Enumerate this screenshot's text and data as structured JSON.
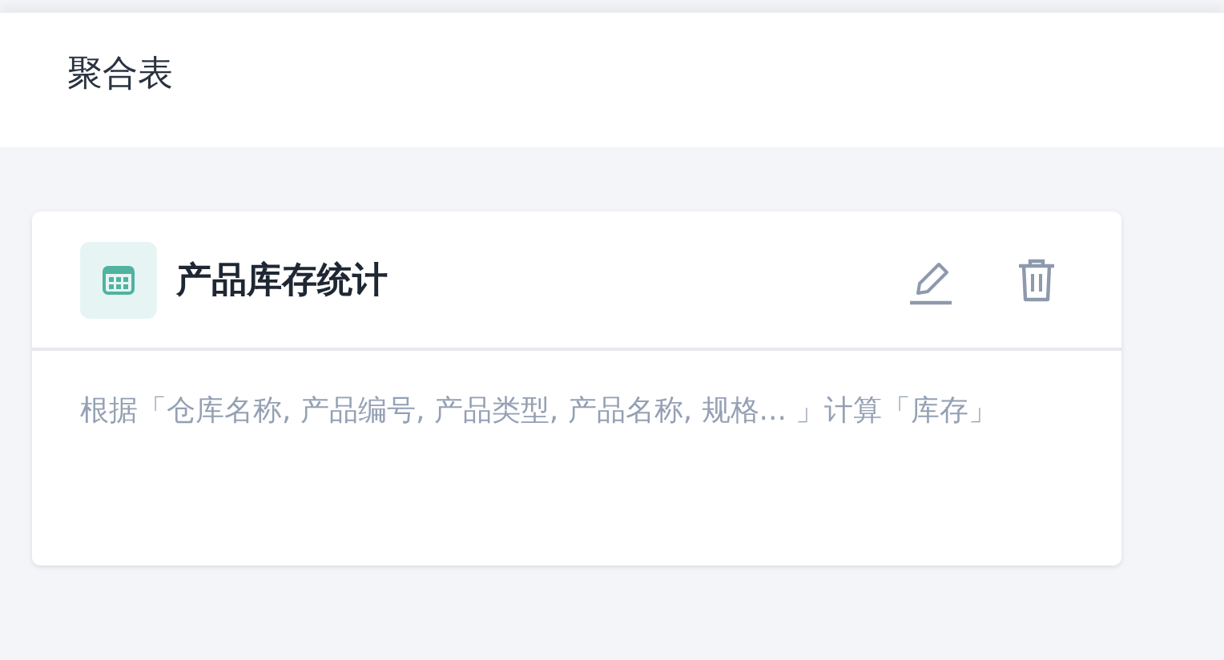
{
  "page": {
    "title": "聚合表"
  },
  "cards": [
    {
      "title": "产品库存统计",
      "description": "根据「仓库名称, 产品编号, 产品类型, 产品名称, 规格... 」计算「库存」"
    }
  ]
}
